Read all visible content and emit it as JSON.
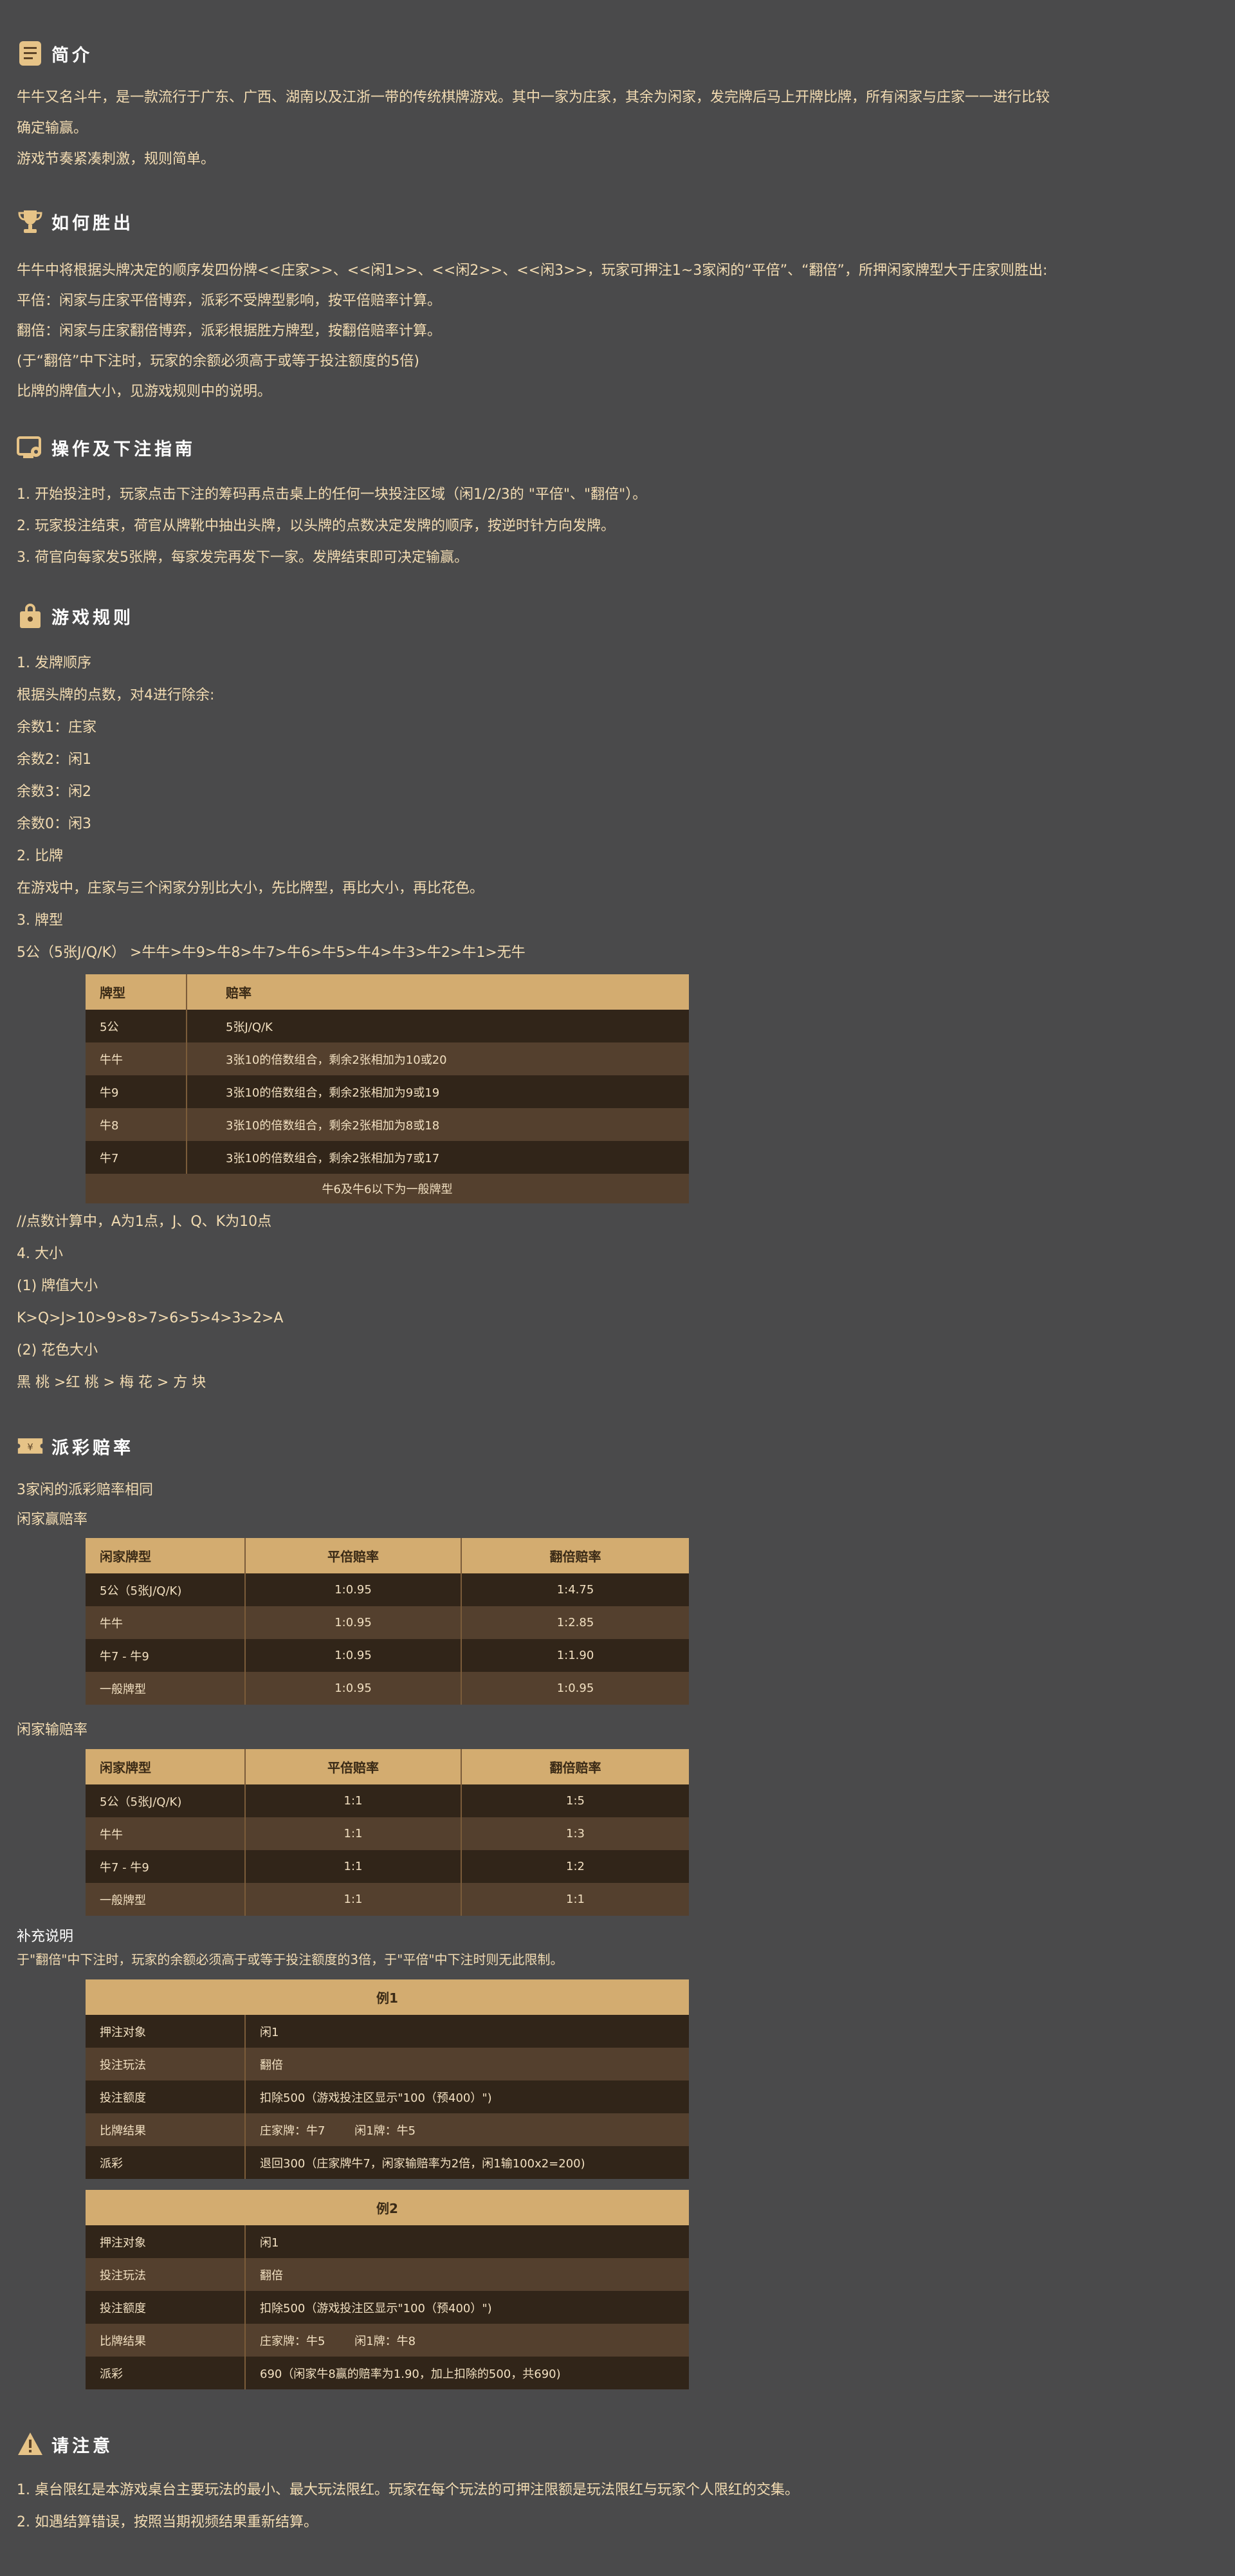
{
  "intro": {
    "title": "简介",
    "lines": [
      "牛牛又名斗牛，是一款流行于广东、广西、湖南以及江浙一带的传统棋牌游戏。其中一家为庄家，其余为闲家，发完牌后马上开牌比牌，所有闲家与庄家一一进行比较",
      "确定输赢。",
      "游戏节奏紧凑刺激，规则简单。"
    ]
  },
  "howto_win": {
    "title": "如何胜出",
    "lines": [
      "牛牛中将根据头牌决定的顺序发四份牌<<庄家>>、<<闲1>>、<<闲2>>、<<闲3>>，玩家可押注1~3家闲的“平倍”、“翻倍”，所押闲家牌型大于庄家则胜出:",
      "平倍：闲家与庄家平倍博弈，派彩不受牌型影响，按平倍赔率计算。",
      "翻倍：闲家与庄家翻倍博弈，派彩根据胜方牌型，按翻倍赔率计算。",
      "(于“翻倍”中下注时，玩家的余额必须高于或等于投注额度的5倍)",
      "比牌的牌值大小，见游戏规则中的说明。"
    ]
  },
  "guide": {
    "title": "操作及下注指南",
    "lines": [
      "1. 开始投注时，玩家点击下注的筹码再点击桌上的任何一块投注区域（闲1/2/3的 \"平倍\"、\"翻倍\"）。",
      "2. 玩家投注结束，荷官从牌靴中抽出头牌，以头牌的点数决定发牌的顺序，按逆时针方向发牌。",
      "3. 荷官向每家发5张牌，每家发完再发下一家。发牌结束即可决定输赢。"
    ]
  },
  "rules": {
    "title": "游戏规则",
    "lines": [
      "1. 发牌顺序",
      "根据头牌的点数，对4进行除余:",
      "余数1：庄家",
      "余数2：闲1",
      "余数3：闲2",
      "余数0：闲3",
      "2. 比牌",
      "在游戏中，庄家与三个闲家分别比大小，先比牌型，再比大小，再比花色。",
      "3. 牌型",
      "5公（5张J/Q/K） >牛牛>牛9>牛8>牛7>牛6>牛5>牛4>牛3>牛2>牛1>无牛"
    ],
    "hand_table": {
      "headers": [
        "牌型",
        "赔率"
      ],
      "rows": [
        [
          "5公",
          "5张J/Q/K"
        ],
        [
          "牛牛",
          "3张10的倍数组合，剩余2张相加为10或20"
        ],
        [
          "牛9",
          "3张10的倍数组合，剩余2张相加为9或19"
        ],
        [
          "牛8",
          "3张10的倍数组合，剩余2张相加为8或18"
        ],
        [
          "牛7",
          "3张10的倍数组合，剩余2张相加为7或17"
        ]
      ],
      "footer": "牛6及牛6以下为一般牌型"
    },
    "lines2": [
      " //点数计算中，A为1点，J、Q、K为10点",
      "4. 大小",
      "(1) 牌值大小",
      "K>Q>J>10>9>8>7>6>5>4>3>2>A",
      "(2) 花色大小",
      "黑 桃 >红 桃 > 梅 花 > 方 块"
    ]
  },
  "payout": {
    "title": "派彩赔率",
    "intro1": "3家闲的派彩赔率相同",
    "win_label": "闲家赢赔率",
    "win_table": {
      "headers": [
        "闲家牌型",
        "平倍赔率",
        "翻倍赔率"
      ],
      "rows": [
        [
          "5公（5张J/Q/K)",
          "1:0.95",
          "1:4.75"
        ],
        [
          "牛牛",
          "1:0.95",
          "1:2.85"
        ],
        [
          "牛7 - 牛9",
          "1:0.95",
          "1:1.90"
        ],
        [
          "一般牌型",
          "1:0.95",
          "1:0.95"
        ]
      ]
    },
    "lose_label": "闲家输赔率",
    "lose_table": {
      "headers": [
        "闲家牌型",
        "平倍赔率",
        "翻倍赔率"
      ],
      "rows": [
        [
          "5公（5张J/Q/K)",
          "1:1",
          "1:5"
        ],
        [
          "牛牛",
          "1:1",
          "1:3"
        ],
        [
          "牛7 - 牛9",
          "1:1",
          "1:2"
        ],
        [
          "一般牌型",
          "1:1",
          "1:1"
        ]
      ]
    },
    "note_title": "补充说明",
    "note_text": "于\"翻倍\"中下注时，玩家的余额必须高于或等于投注额度的3倍，于\"平倍\"中下注时则无此限制。",
    "example1": {
      "title": "例1",
      "rows": [
        [
          "押注对象",
          "闲1"
        ],
        [
          "投注玩法",
          "翻倍"
        ],
        [
          "投注额度",
          "扣除500（游戏投注区显示\"100（预400）\")"
        ],
        [
          "比牌结果",
          "庄家牌：牛7        闲1牌：牛5"
        ],
        [
          "派彩",
          "退回300（庄家牌牛7，闲家输赔率为2倍，闲1输100x2=200)"
        ]
      ]
    },
    "example2": {
      "title": "例2",
      "rows": [
        [
          "押注对象",
          "闲1"
        ],
        [
          "投注玩法",
          "翻倍"
        ],
        [
          "投注额度",
          "扣除500（游戏投注区显示\"100（预400）\")"
        ],
        [
          "比牌结果",
          "庄家牌：牛5        闲1牌：牛8"
        ],
        [
          "派彩",
          "690（闲家牛8赢的赔率为1.90，加上扣除的500，共690)"
        ]
      ]
    }
  },
  "notice": {
    "title": "请注意",
    "lines": [
      "1. 桌台限红是本游戏桌台主要玩法的最小、最大玩法限红。玩家在每个玩法的可押注限额是玩法限红与玩家个人限红的交集。",
      "2. 如遇结算错误，按照当期视频结果重新结算。"
    ]
  },
  "colors": {
    "background": "#4a4a4b",
    "text": "#f3dcb2",
    "header_gold": "#d3ac70",
    "row_dark": "#312519",
    "row_light": "#54402e"
  }
}
